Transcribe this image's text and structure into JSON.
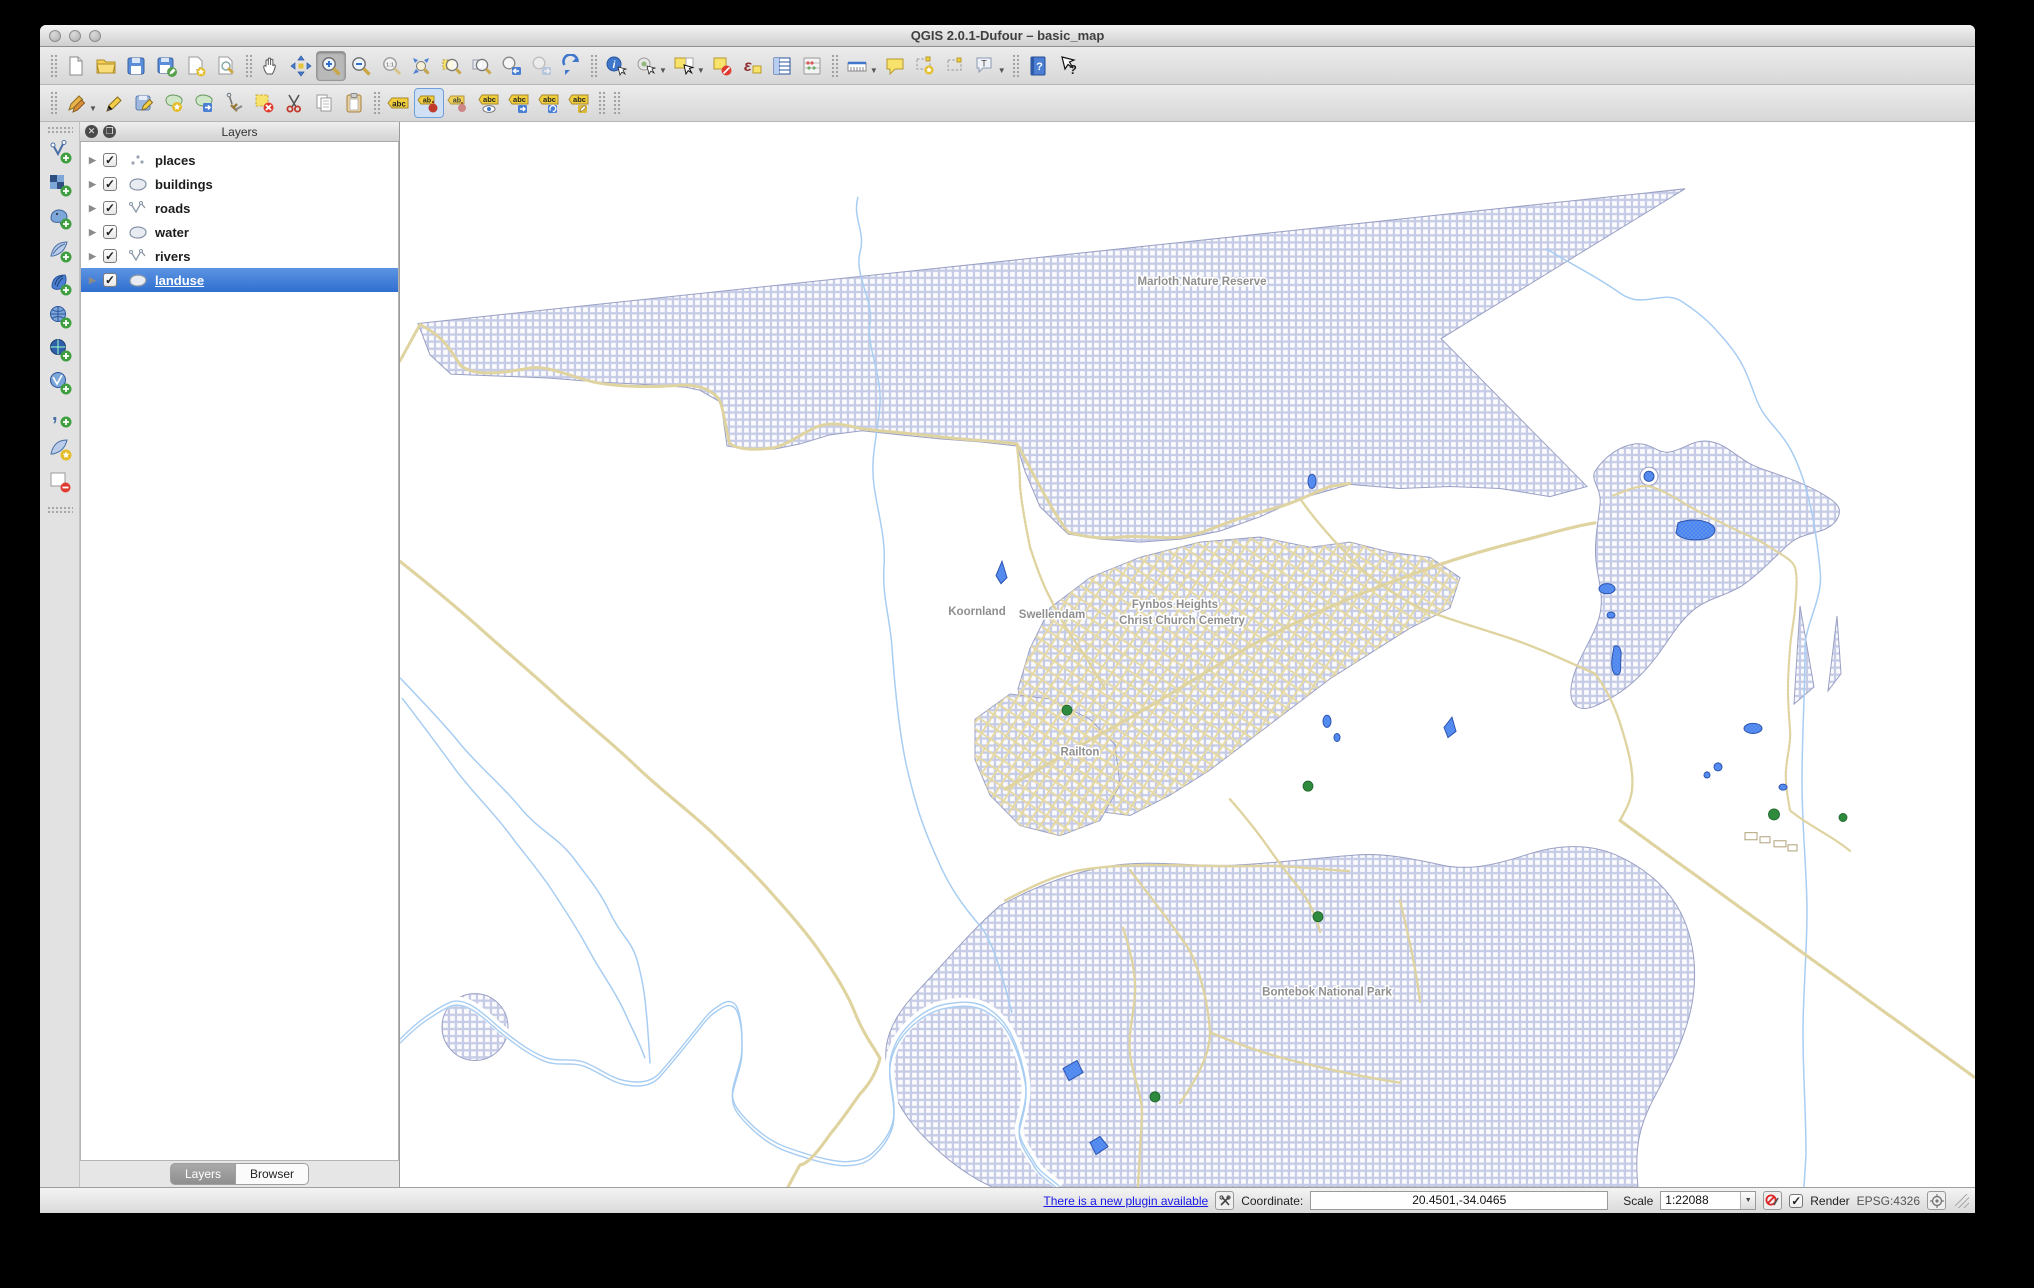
{
  "window": {
    "title": "QGIS 2.0.1-Dufour – basic_map"
  },
  "toolbar_top": {
    "icons": [
      "new-project",
      "open-project",
      "save-project",
      "save-project-as",
      "new-composer",
      "composer-manager",
      "pan-map",
      "pan-to-selection",
      "zoom-in",
      "zoom-out",
      "zoom-native",
      "zoom-full",
      "zoom-selection",
      "zoom-layer",
      "zoom-last",
      "zoom-next",
      "refresh-map",
      "identify-features",
      "run-feature-action",
      "select-rectangle",
      "deselect-all",
      "select-expression",
      "attribute-table",
      "field-calculator",
      "measure-line",
      "map-tips",
      "new-bookmark",
      "show-bookmarks",
      "text-annotation",
      "help-contents",
      "whats-this"
    ]
  },
  "toolbar_edit": {
    "icons": [
      "current-edits",
      "toggle-editing",
      "save-layer-edits",
      "add-feature",
      "move-feature",
      "node-tool",
      "delete-selected",
      "cut-features",
      "copy-features",
      "paste-features",
      "labeling",
      "label-pin",
      "label-unpin",
      "label-visibility",
      "label-move",
      "label-rotate",
      "label-properties"
    ]
  },
  "left_toolbar": {
    "icons": [
      "add-vector-layer",
      "add-raster-layer",
      "add-postgis-layer",
      "add-spatialite-layer",
      "add-mssql-layer",
      "add-wms-layer",
      "add-wcs-layer",
      "add-wfs-layer",
      "add-delimited-text-layer",
      "new-spatialite-layer",
      "remove-layer"
    ]
  },
  "layers_panel": {
    "title": "Layers",
    "items": [
      {
        "label": "places",
        "type": "point",
        "checked": true,
        "selected": false
      },
      {
        "label": "buildings",
        "type": "polygon",
        "checked": true,
        "selected": false
      },
      {
        "label": "roads",
        "type": "line",
        "checked": true,
        "selected": false
      },
      {
        "label": "water",
        "type": "polygon",
        "checked": true,
        "selected": false
      },
      {
        "label": "rivers",
        "type": "line",
        "checked": true,
        "selected": false
      },
      {
        "label": "landuse",
        "type": "polygon",
        "checked": true,
        "selected": true
      }
    ],
    "tabs": [
      {
        "label": "Layers",
        "active": true
      },
      {
        "label": "Browser",
        "active": false
      }
    ],
    "check_glyph": "✓"
  },
  "map": {
    "labels": [
      {
        "text": "Marloth Nature Reserve"
      },
      {
        "text": "Koornland"
      },
      {
        "text": "Swellendam"
      },
      {
        "text": "Fynbos Heights"
      },
      {
        "text": "Christ Church Cemetry"
      },
      {
        "text": "Railton"
      },
      {
        "text": "Bontebok National Park"
      }
    ]
  },
  "status_bar": {
    "plugin_link": "There is a new plugin available",
    "coordinate_label": "Coordinate:",
    "coordinate_value": "20.4501,-34.0465",
    "scale_label": "Scale",
    "scale_value": "1:22088",
    "render_label": "Render",
    "render_checked": "✓",
    "crs": "EPSG:4326",
    "icons": [
      "plugin-icon",
      "stop-render-icon",
      "crs-status-icon",
      "resize-grip"
    ]
  },
  "colors": {
    "selection_blue": "#3c76d6",
    "landuse_fill": "#c6cce6",
    "landuse_stroke": "#9aa0c4",
    "water_fill": "#5e97ea",
    "river": "#a8cdf2",
    "road": "#dfd3a0",
    "place_dot": "#2e8b3d",
    "label_gray": "#8f8f8f"
  }
}
